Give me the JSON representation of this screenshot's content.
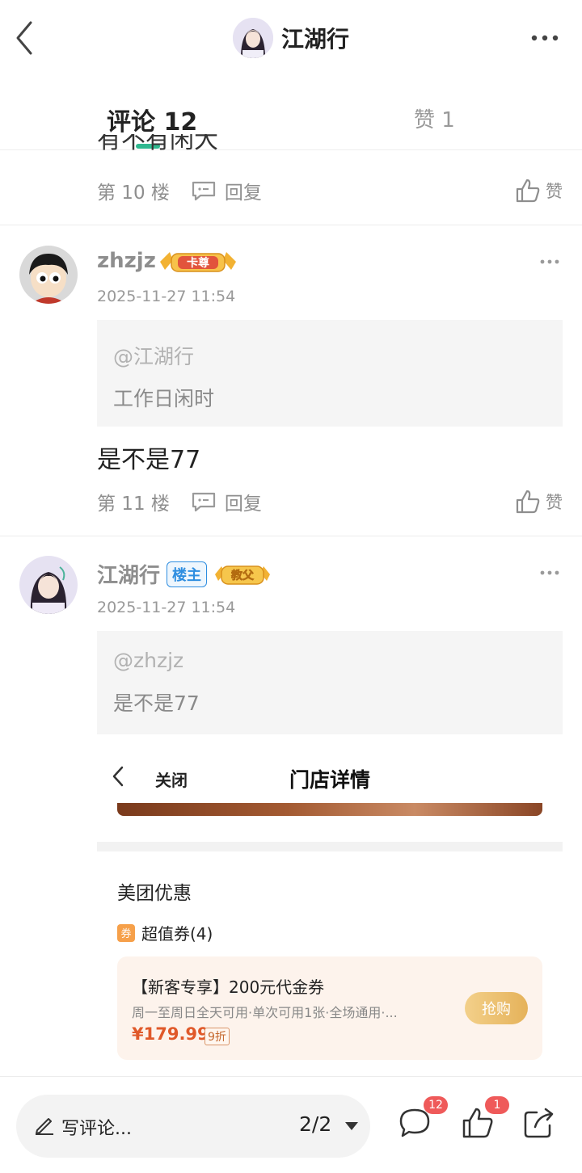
{
  "header": {
    "title": "江湖行"
  },
  "tabs": {
    "comments_label": "评论 12",
    "likes_label": "赞 1"
  },
  "partial_comment": {
    "text": "有不有闲大",
    "floor": "第 10 楼",
    "reply_label": "回复",
    "like_label": "赞"
  },
  "comment_11": {
    "username": "zhzjz",
    "badge": "卡尊",
    "time": "2025-11-27 11:54",
    "quote_at": "@江湖行",
    "quote_text": "工作日闲时",
    "text": "是不是77",
    "floor": "第 11 楼",
    "reply_label": "回复",
    "like_label": "赞"
  },
  "comment_12": {
    "username": "江湖行",
    "owner_tag": "楼主",
    "badge": "教父",
    "time": "2025-11-27 11:54",
    "quote_at": "@zhzjz",
    "quote_text": "是不是77"
  },
  "embedded_screenshot": {
    "close_label": "关闭",
    "title": "门店详情",
    "section_title": "美团优惠",
    "coupon_kind": "超值券(4)",
    "coupon_icon_char": "券",
    "coupon_name": "【新客专享】200元代金券",
    "coupon_desc": "周一至周日全天可用·单次可用1张·全场通用·...",
    "coupon_price": "¥179.99",
    "coupon_discount": "9折",
    "grab_label": "抢购"
  },
  "bottom_bar": {
    "write_placeholder": "写评论...",
    "page_indicator": "2/2",
    "comment_count": "12",
    "like_count": "1"
  },
  "colors": {
    "accent_green": "#2fb88f",
    "badge_red": "#ef5a5a",
    "owner_blue": "#2f8ee0",
    "price_orange": "#e0592a"
  }
}
